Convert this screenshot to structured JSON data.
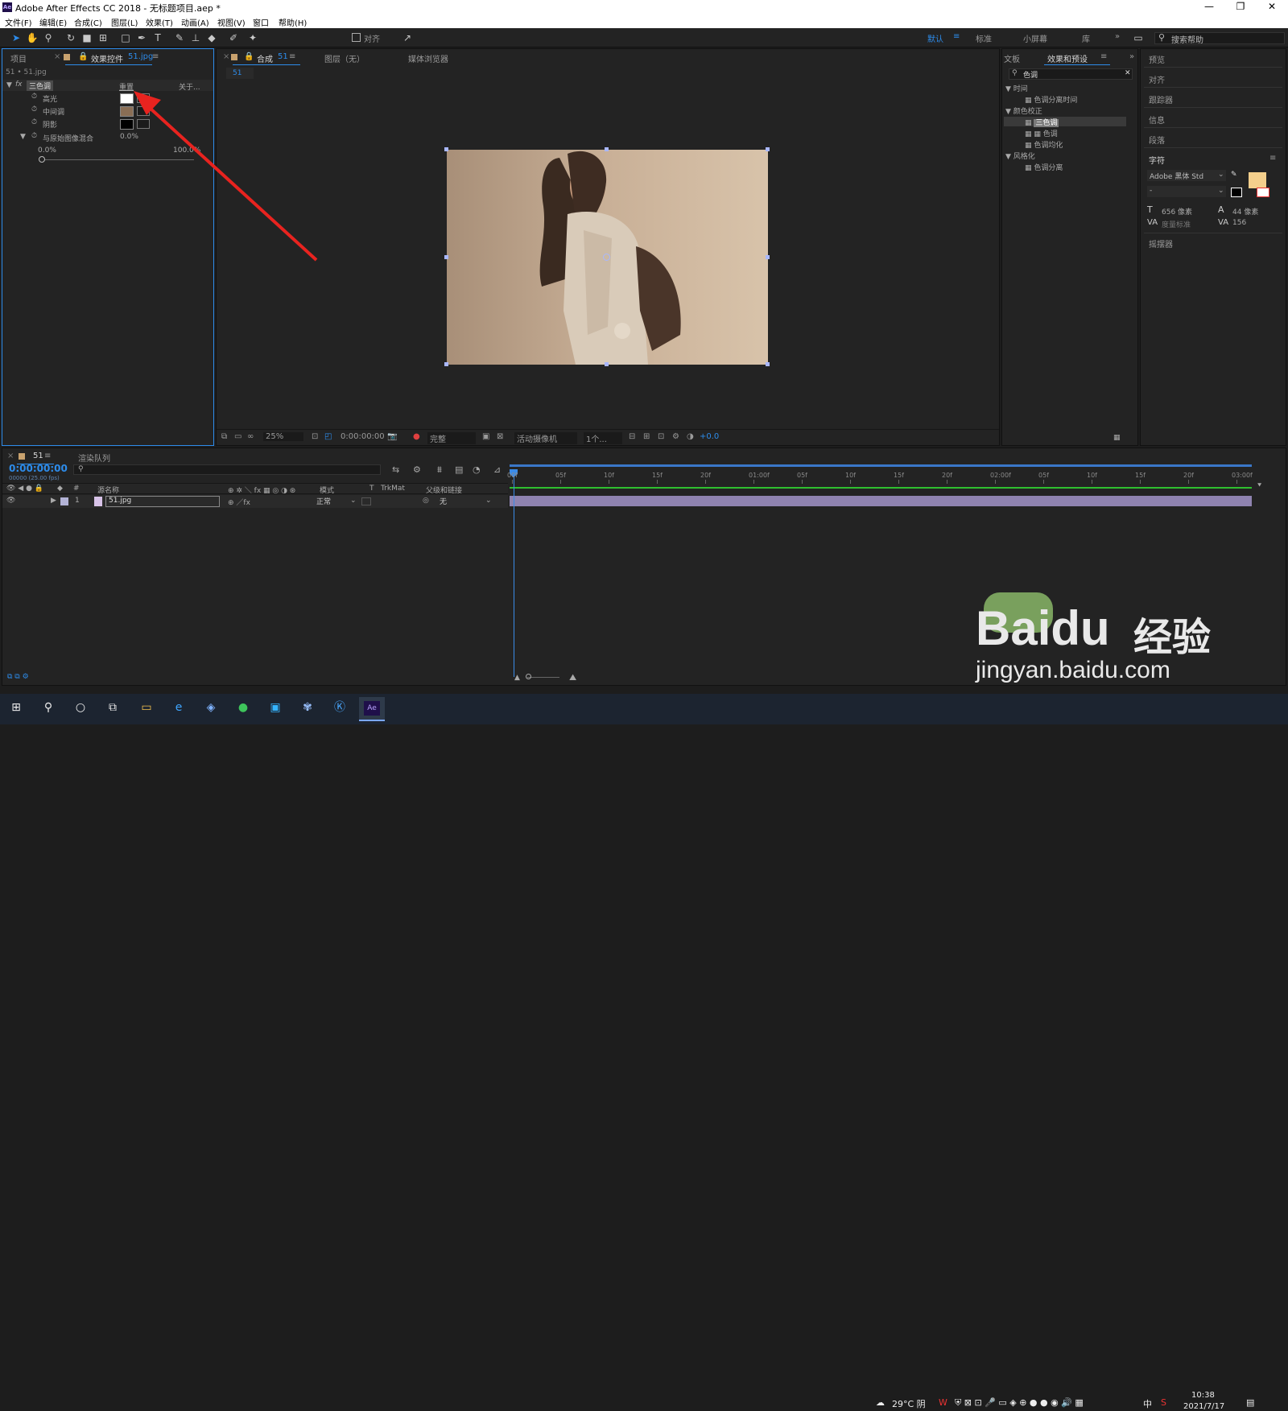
{
  "window": {
    "title": "Adobe After Effects CC 2018 - 无标题项目.aep *",
    "minimize": "—",
    "maximize": "❐",
    "close": "✕",
    "app_badge": "Ae"
  },
  "menu": [
    "文件(F)",
    "编辑(E)",
    "合成(C)",
    "图层(L)",
    "效果(T)",
    "动画(A)",
    "视图(V)",
    "窗口",
    "帮助(H)"
  ],
  "toolbar": {
    "align_label": "对齐",
    "workspaces": [
      "默认",
      "标准",
      "小屏幕",
      "库"
    ],
    "search_placeholder": "搜索帮助",
    "overflow": "»"
  },
  "project_panel": {
    "tab_project": "项目",
    "tab_effects": "效果控件",
    "effects_file": "51.jpg",
    "breadcrumb": "51 • 51.jpg",
    "effect": {
      "fx": "fx",
      "name": "三色调",
      "reset": "重置",
      "about": "关于...",
      "props": [
        {
          "label": "高光",
          "color": "#ffffff"
        },
        {
          "label": "中间调",
          "color": "#8a6e55"
        },
        {
          "label": "阴影",
          "color": "#000000"
        }
      ],
      "blend_label": "与原始图像混合",
      "blend_value": "0.0%",
      "slider_min": "0.0%",
      "slider_max": "100.0%",
      "blend_fraction": 0.0
    }
  },
  "viewer": {
    "tab_comp": "合成",
    "comp_name": "51",
    "tab_layer": "图层（无）",
    "tab_browser": "媒体浏览器",
    "comp_chip": "51",
    "bottom": {
      "zoom": "25%",
      "time": "0:00:00:00",
      "quality": "完整",
      "camera": "活动摄像机",
      "views": "1个...",
      "exposure": "+0.0"
    }
  },
  "effects_presets": {
    "tab_text": "文板",
    "tab_main": "效果和预设",
    "search_value": "色调",
    "tree": [
      {
        "group": "时间",
        "items": [
          "色调分离时间"
        ]
      },
      {
        "group": "颜色校正",
        "items": [
          "三色调",
          "色调",
          "色调均化"
        ]
      },
      {
        "group": "风格化",
        "items": [
          "色调分离"
        ]
      }
    ]
  },
  "right_panel": {
    "items": [
      "预览",
      "对齐",
      "跟踪器",
      "信息",
      "段落",
      "字符"
    ],
    "wiggler": "摇摆器",
    "font_family": "Adobe 黑体 Std",
    "font_style": "-",
    "font_size": "656 像素",
    "leading": "44 像素",
    "kerning": "度量标准",
    "tracking": "156",
    "fill_color": "#f4cf8c"
  },
  "timeline": {
    "tab_comp": "51",
    "tab_render": "渲染队列",
    "timecode": "0:00:00:00",
    "fps": "00000 (25.00 fps)",
    "col_headers": [
      "源名称",
      "模式",
      "T",
      "TrkMat",
      "父级和链接"
    ],
    "layer": {
      "index": "1",
      "name": "51.jpg",
      "mode": "正常",
      "parent": "无"
    },
    "ruler": [
      "00f",
      "05f",
      "10f",
      "15f",
      "20f",
      "01:00f",
      "05f",
      "10f",
      "15f",
      "20f",
      "02:00f",
      "05f",
      "10f",
      "15f",
      "20f",
      "03:00f"
    ]
  },
  "taskbar": {
    "weather": "29°C 阴",
    "lang": "中",
    "time": "10:38",
    "date": "2021/7/17"
  },
  "watermark": {
    "brand": "Baidu",
    "text": "经验",
    "url": "jingyan.baidu.com"
  },
  "colors": {
    "accent": "#2d8ceb",
    "annotation_arrow": "#e8231f",
    "layer_bar": "#8f83b0",
    "green_bar": "#2fbf2f"
  }
}
